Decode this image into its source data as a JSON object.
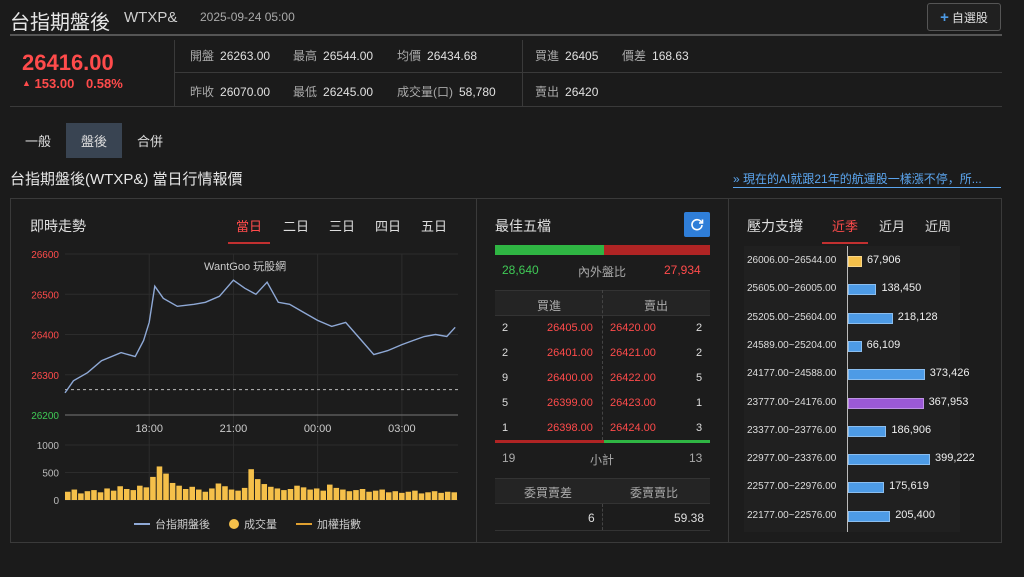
{
  "header": {
    "title": "台指期盤後",
    "symbol": "WTXP&",
    "datetime": "2025-09-24 05:00",
    "watch_label": "自選股",
    "watch_icon": "plus-icon"
  },
  "quote": {
    "price": "26416.00",
    "change": "153.00",
    "change_pct": "0.58%",
    "up_arrow": "▲",
    "open_label": "開盤",
    "open": "26263.00",
    "high_label": "最高",
    "high": "26544.00",
    "avg_label": "均價",
    "avg": "26434.68",
    "prev_label": "昨收",
    "prev": "26070.00",
    "low_label": "最低",
    "low": "26245.00",
    "vol_label": "成交量(口)",
    "vol": "58,780",
    "bid_label": "買進",
    "bid": "26405",
    "spread_label": "價差",
    "spread": "168.63",
    "ask_label": "賣出",
    "ask": "26420"
  },
  "tabs": [
    "一般",
    "盤後",
    "合併"
  ],
  "active_tab": 1,
  "section_title": "台指期盤後(WTXP&) 當日行情報價",
  "news_link": "» 現在的AI就跟21年的航運股一樣漲不停，所...",
  "trend": {
    "title": "即時走勢",
    "range_tabs": [
      "當日",
      "二日",
      "三日",
      "四日",
      "五日"
    ],
    "watermark": "WantGoo 玩股網",
    "legend": {
      "line": "台指期盤後",
      "volume": "成交量",
      "index": "加權指數"
    },
    "colors": {
      "line": "#8fa9d6",
      "volume": "#f5c04a",
      "index": "#e0a030",
      "up": "#ff4b4b",
      "down": "#3fca56"
    }
  },
  "chart_data": [
    {
      "type": "line",
      "title": "",
      "x_ticks": [
        "18:00",
        "21:00",
        "00:00",
        "03:00"
      ],
      "y_ticks": [
        "26600",
        "26500",
        "26400",
        "26300",
        "26200"
      ],
      "ylim": [
        26200,
        26600
      ],
      "baseline": 26263,
      "x_hours_from_1500": [
        0,
        0.3,
        0.8,
        1.3,
        2.0,
        2.5,
        2.8,
        3.0,
        3.2,
        3.5,
        4.0,
        4.6,
        5.0,
        5.5,
        6.0,
        6.4,
        6.8,
        7.2,
        7.6,
        8.0,
        8.5,
        9.0,
        9.5,
        10.0,
        10.5,
        11.0,
        11.5,
        12.0,
        12.4,
        12.8,
        13.2,
        13.6,
        13.9
      ],
      "series": [
        {
          "values": [
            26255,
            26285,
            26305,
            26335,
            26355,
            26345,
            26385,
            26430,
            26520,
            26490,
            26470,
            26475,
            26480,
            26495,
            26535,
            26515,
            26500,
            26530,
            26480,
            26475,
            26455,
            26435,
            26420,
            26430,
            26390,
            26350,
            26360,
            26375,
            26385,
            26395,
            26400,
            26395,
            26418
          ]
        }
      ]
    },
    {
      "type": "bar",
      "title": "",
      "y_ticks": [
        "1000",
        "500",
        "0"
      ],
      "ylim": [
        0,
        1000
      ],
      "note": "volume per minute",
      "series": [
        {
          "name": "成交量",
          "values": [
            150,
            190,
            120,
            160,
            180,
            140,
            210,
            170,
            250,
            200,
            180,
            260,
            230,
            420,
            610,
            480,
            310,
            260,
            200,
            240,
            190,
            150,
            210,
            300,
            250,
            190,
            170,
            220,
            560,
            380,
            290,
            240,
            210,
            180,
            200,
            260,
            230,
            190,
            210,
            170,
            280,
            220,
            190,
            160,
            180,
            200,
            150,
            170,
            190,
            140,
            160,
            130,
            150,
            170,
            120,
            140,
            160,
            130,
            150,
            140
          ]
        }
      ]
    }
  ],
  "orderbook": {
    "title": "最佳五檔",
    "refresh_icon": "refresh-icon",
    "buy_total": "28,640",
    "ratio_label": "內外盤比",
    "sell_total": "27,934",
    "buy_share": 0.506,
    "headers": [
      "買進",
      "賣出"
    ],
    "rows": [
      {
        "bq": "2",
        "bp": "26405.00",
        "ap": "26420.00",
        "aq": "2"
      },
      {
        "bq": "2",
        "bp": "26401.00",
        "ap": "26421.00",
        "aq": "2"
      },
      {
        "bq": "9",
        "bp": "26400.00",
        "ap": "26422.00",
        "aq": "5"
      },
      {
        "bq": "5",
        "bp": "26399.00",
        "ap": "26423.00",
        "aq": "1"
      },
      {
        "bq": "1",
        "bp": "26398.00",
        "ap": "26424.00",
        "aq": "3"
      }
    ],
    "sum_buy": "19",
    "sum_label": "小計",
    "sum_sell": "13",
    "diff_headers": [
      "委買賣差",
      "委賣賣比"
    ],
    "diff_values": [
      "6",
      "59.38"
    ]
  },
  "pressure": {
    "title": "壓力支撐",
    "tabs": [
      "近季",
      "近月",
      "近周"
    ],
    "max": 399222,
    "rows": [
      {
        "range": "26006.00~26544.00",
        "value": "67,906",
        "v": 67906,
        "color": "#f5c04a"
      },
      {
        "range": "25605.00~26005.00",
        "value": "138,450",
        "v": 138450,
        "color": "#4d9be6"
      },
      {
        "range": "25205.00~25604.00",
        "value": "218,128",
        "v": 218128,
        "color": "#4d9be6"
      },
      {
        "range": "24589.00~25204.00",
        "value": "66,109",
        "v": 66109,
        "color": "#4d9be6"
      },
      {
        "range": "24177.00~24588.00",
        "value": "373,426",
        "v": 373426,
        "color": "#4d9be6"
      },
      {
        "range": "23777.00~24176.00",
        "value": "367,953",
        "v": 367953,
        "color": "#9b59d6"
      },
      {
        "range": "23377.00~23776.00",
        "value": "186,906",
        "v": 186906,
        "color": "#4d9be6"
      },
      {
        "range": "22977.00~23376.00",
        "value": "399,222",
        "v": 399222,
        "color": "#4d9be6"
      },
      {
        "range": "22577.00~22976.00",
        "value": "175,619",
        "v": 175619,
        "color": "#4d9be6"
      },
      {
        "range": "22177.00~22576.00",
        "value": "205,400",
        "v": 205400,
        "color": "#4d9be6"
      }
    ]
  }
}
